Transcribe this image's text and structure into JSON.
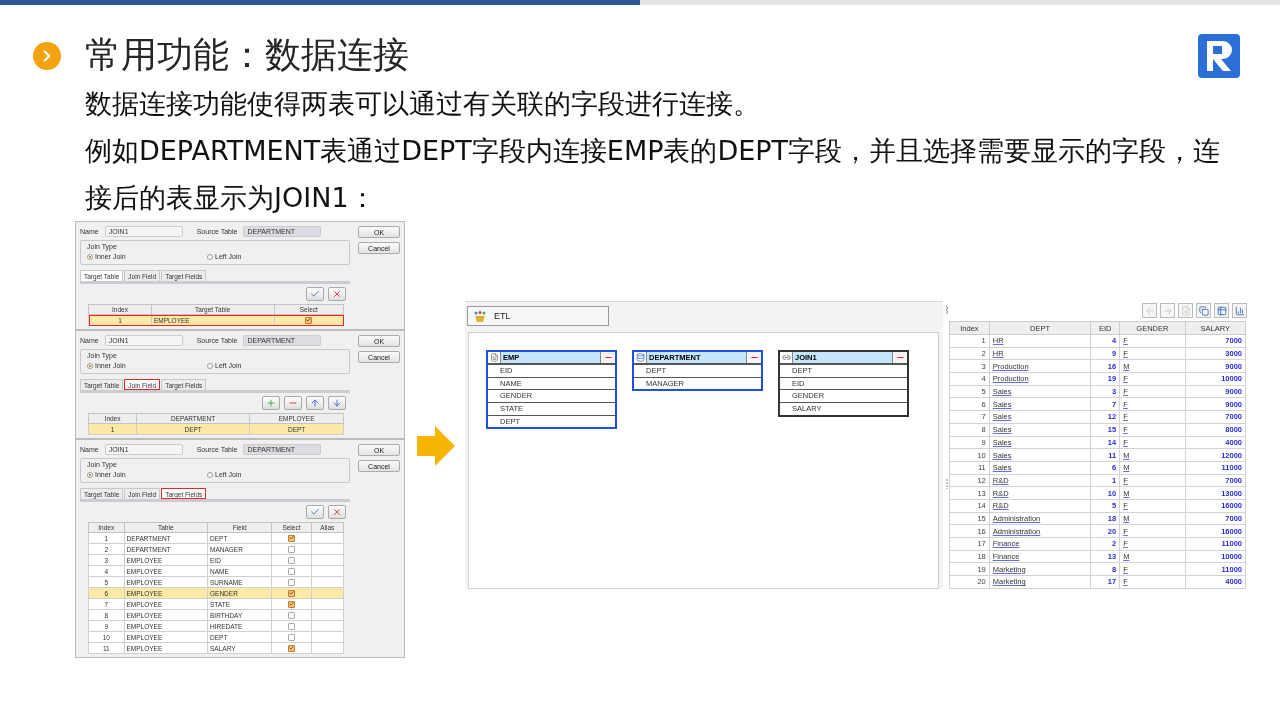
{
  "progress": {
    "level": 0.5
  },
  "title": "常用功能：数据连接",
  "paragraphs": [
    "数据连接功能使得两表可以通过有关联的字段进行连接。",
    "例如DEPARTMENT表通过DEPT字段内连接EMP表的DEPT字段，并且选择需要显示的字段，连接后的表显示为JOIN1："
  ],
  "dialogs": [
    {
      "name_label": "Name",
      "name": "JOIN1",
      "source_label": "Source Table",
      "source": "DEPARTMENT",
      "ok": "OK",
      "cancel": "Cancel",
      "join_type_label": "Join Type",
      "join_options": [
        {
          "label": "Inner Join",
          "selected": true
        },
        {
          "label": "Left Join",
          "selected": false
        }
      ],
      "tabs": [
        {
          "label": "Target Table",
          "selected": true,
          "outlined": false
        },
        {
          "label": "Join Field",
          "selected": false,
          "outlined": false
        },
        {
          "label": "Target Fields",
          "selected": false,
          "outlined": false
        }
      ],
      "tools": [
        {
          "kind": "check-all"
        },
        {
          "kind": "clear"
        }
      ],
      "table": {
        "columns": [
          {
            "label": "Index",
            "kind": "index"
          },
          {
            "label": "Target Table",
            "kind": "text"
          },
          {
            "label": "Select",
            "kind": "check"
          }
        ],
        "rows": [
          {
            "cells": [
              "1",
              "EMPLOYEE"
            ],
            "checked": true,
            "highlighted": true,
            "outlined": true
          }
        ]
      }
    },
    {
      "name_label": "Name",
      "name": "JOIN1",
      "source_label": "Source Table",
      "source": "DEPARTMENT",
      "ok": "OK",
      "cancel": "Cancel",
      "join_type_label": "Join Type",
      "join_options": [
        {
          "label": "Inner Join",
          "selected": true
        },
        {
          "label": "Left Join",
          "selected": false
        }
      ],
      "tabs": [
        {
          "label": "Target Table",
          "selected": false,
          "outlined": false
        },
        {
          "label": "Join Field",
          "selected": true,
          "outlined": true
        },
        {
          "label": "Target Fields",
          "selected": false,
          "outlined": false
        }
      ],
      "tools": [
        {
          "kind": "add"
        },
        {
          "kind": "remove"
        },
        {
          "kind": "up"
        },
        {
          "kind": "down"
        }
      ],
      "table": {
        "columns": [
          {
            "label": "Index",
            "kind": "index"
          },
          {
            "label": "DEPARTMENT",
            "kind": "center"
          },
          {
            "label": "EMPLOYEE",
            "kind": "center"
          }
        ],
        "rows": [
          {
            "cells": [
              "1",
              "DEPT",
              "DEPT"
            ],
            "highlighted": true,
            "outlined": false
          }
        ]
      }
    },
    {
      "name_label": "Name",
      "name": "JOIN1",
      "source_label": "Source Table",
      "source": "DEPARTMENT",
      "ok": "OK",
      "cancel": "Cancel",
      "join_type_label": "Join Type",
      "join_options": [
        {
          "label": "Inner Join",
          "selected": true
        },
        {
          "label": "Left Join",
          "selected": false
        }
      ],
      "tabs": [
        {
          "label": "Target Table",
          "selected": false,
          "outlined": false
        },
        {
          "label": "Join Field",
          "selected": false,
          "outlined": false
        },
        {
          "label": "Target Fields",
          "selected": true,
          "outlined": true
        }
      ],
      "tools": [
        {
          "kind": "check-all"
        },
        {
          "kind": "clear"
        }
      ],
      "table": {
        "columns": [
          {
            "label": "Index",
            "kind": "index"
          },
          {
            "label": "Table",
            "kind": "text"
          },
          {
            "label": "Field",
            "kind": "text"
          },
          {
            "label": "Select",
            "kind": "check"
          },
          {
            "label": "Alias",
            "kind": "blank"
          }
        ],
        "rows": [
          {
            "cells": [
              "1",
              "DEPARTMENT",
              "DEPT"
            ],
            "checked": true,
            "highlighted": false,
            "outlined": false
          },
          {
            "cells": [
              "2",
              "DEPARTMENT",
              "MANAGER"
            ],
            "checked": false,
            "highlighted": false,
            "outlined": false
          },
          {
            "cells": [
              "3",
              "EMPLOYEE",
              "EID"
            ],
            "checked": false,
            "highlighted": false,
            "outlined": false
          },
          {
            "cells": [
              "4",
              "EMPLOYEE",
              "NAME"
            ],
            "checked": false,
            "highlighted": false,
            "outlined": false
          },
          {
            "cells": [
              "5",
              "EMPLOYEE",
              "SURNAME"
            ],
            "checked": false,
            "highlighted": false,
            "outlined": false
          },
          {
            "cells": [
              "6",
              "EMPLOYEE",
              "GENDER"
            ],
            "checked": true,
            "highlighted": true,
            "outlined": false
          },
          {
            "cells": [
              "7",
              "EMPLOYEE",
              "STATE"
            ],
            "checked": true,
            "highlighted": false,
            "outlined": false
          },
          {
            "cells": [
              "8",
              "EMPLOYEE",
              "BIRTHDAY"
            ],
            "checked": false,
            "highlighted": false,
            "outlined": false
          },
          {
            "cells": [
              "9",
              "EMPLOYEE",
              "HIREDATE"
            ],
            "checked": false,
            "highlighted": false,
            "outlined": false
          },
          {
            "cells": [
              "10",
              "EMPLOYEE",
              "DEPT"
            ],
            "checked": false,
            "highlighted": false,
            "outlined": false
          },
          {
            "cells": [
              "11",
              "EMPLOYEE",
              "SALARY"
            ],
            "checked": true,
            "highlighted": false,
            "outlined": false
          }
        ]
      }
    }
  ],
  "etl": {
    "tab": "ETL",
    "nodes": [
      {
        "title": "EMP",
        "kind": "file",
        "highlighted": true,
        "fields": [
          "EID",
          "NAME",
          "GENDER",
          "STATE",
          "DEPT"
        ]
      },
      {
        "title": "DEPARTMENT",
        "kind": "database",
        "highlighted": true,
        "fields": [
          "DEPT",
          "MANAGER"
        ]
      },
      {
        "title": "JOIN1",
        "kind": "join",
        "highlighted": false,
        "fields": [
          "DEPT",
          "EID",
          "GENDER",
          "SALARY"
        ]
      }
    ]
  },
  "result": {
    "toolbar": [
      {
        "kind": "back",
        "disabled": true
      },
      {
        "kind": "forward",
        "disabled": true
      },
      {
        "kind": "preview",
        "disabled": true
      },
      {
        "kind": "copy",
        "disabled": false
      },
      {
        "kind": "export",
        "disabled": false
      },
      {
        "kind": "chart",
        "disabled": false
      }
    ],
    "columns": [
      {
        "label": "Index",
        "kind": "index"
      },
      {
        "label": "DEPT",
        "kind": "link"
      },
      {
        "label": "EID",
        "kind": "number"
      },
      {
        "label": "GENDER",
        "kind": "link"
      },
      {
        "label": "SALARY",
        "kind": "number"
      }
    ],
    "rows": [
      [
        "1",
        "HR",
        "4",
        "F",
        "7000"
      ],
      [
        "2",
        "HR",
        "9",
        "F",
        "3000"
      ],
      [
        "3",
        "Production",
        "16",
        "M",
        "9000"
      ],
      [
        "4",
        "Production",
        "19",
        "F",
        "10000"
      ],
      [
        "5",
        "Sales",
        "3",
        "F",
        "9000"
      ],
      [
        "6",
        "Sales",
        "7",
        "F",
        "9000"
      ],
      [
        "7",
        "Sales",
        "12",
        "F",
        "7000"
      ],
      [
        "8",
        "Sales",
        "15",
        "F",
        "8000"
      ],
      [
        "9",
        "Sales",
        "14",
        "F",
        "4000"
      ],
      [
        "10",
        "Sales",
        "11",
        "M",
        "12000"
      ],
      [
        "11",
        "Sales",
        "6",
        "M",
        "11000"
      ],
      [
        "12",
        "R&D",
        "1",
        "F",
        "7000"
      ],
      [
        "13",
        "R&D",
        "10",
        "M",
        "13000"
      ],
      [
        "14",
        "R&D",
        "5",
        "F",
        "16000"
      ],
      [
        "15",
        "Administration",
        "18",
        "M",
        "7000"
      ],
      [
        "16",
        "Administration",
        "20",
        "F",
        "16000"
      ],
      [
        "17",
        "Finance",
        "2",
        "F",
        "11000"
      ],
      [
        "18",
        "Finance",
        "13",
        "M",
        "10000"
      ],
      [
        "19",
        "Marketing",
        "8",
        "F",
        "11000"
      ],
      [
        "20",
        "Marketing",
        "17",
        "F",
        "4000"
      ]
    ]
  }
}
